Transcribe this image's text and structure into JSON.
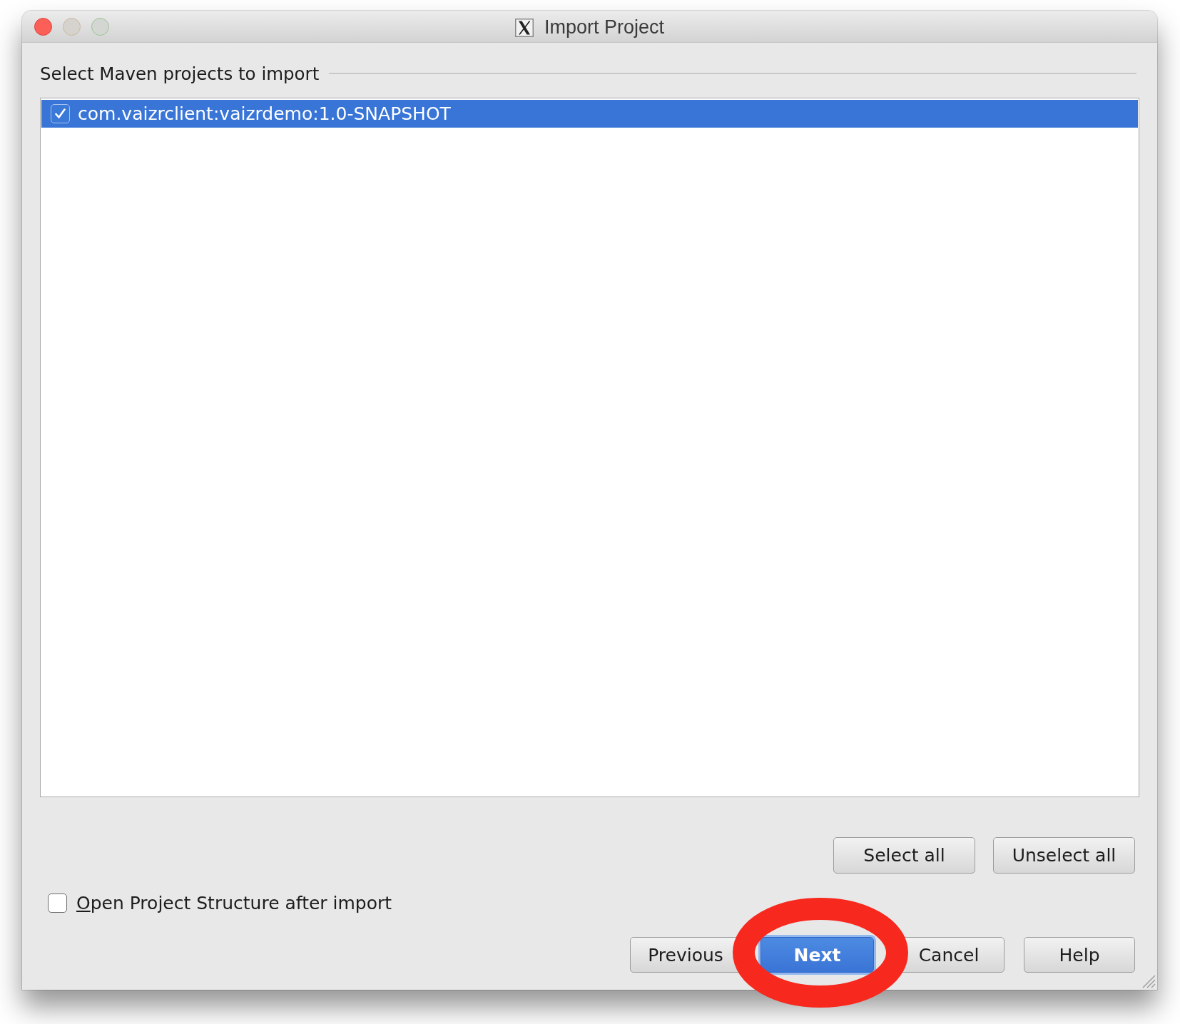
{
  "window": {
    "title": "Import Project",
    "controls": [
      {
        "kind": "close",
        "disabled": false
      },
      {
        "kind": "minimize",
        "disabled": true
      },
      {
        "kind": "zoom",
        "disabled": true
      }
    ]
  },
  "group": {
    "label": "Select Maven projects to import"
  },
  "projects": [
    {
      "name": "com.vaizrclient:vaizrdemo:1.0-SNAPSHOT",
      "checked": true,
      "selected": true
    }
  ],
  "select_all": {
    "label": "Select all"
  },
  "unselect_all": {
    "label": "Unselect all"
  },
  "open_structure": {
    "label": "Open Project Structure after import",
    "checked": false
  },
  "nav_buttons": [
    {
      "kind": "previous",
      "label": "Previous",
      "default": false,
      "highlighted": false
    },
    {
      "kind": "next",
      "label": "Next",
      "default": true,
      "highlighted": true
    },
    {
      "kind": "cancel",
      "label": "Cancel",
      "default": false,
      "highlighted": false
    },
    {
      "kind": "help",
      "label": "Help",
      "default": false,
      "highlighted": false
    }
  ]
}
